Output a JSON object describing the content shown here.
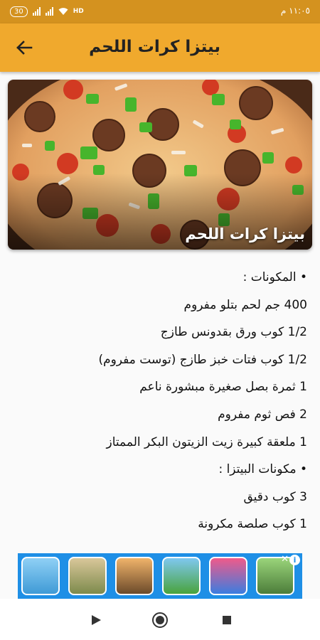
{
  "status_bar": {
    "time": "١١:٠٥ م",
    "battery": "30",
    "network": "HD"
  },
  "app_bar": {
    "title": "بيتزا كرات اللحم",
    "back_icon": "arrow-back-icon"
  },
  "hero": {
    "caption": "بيتزا كرات اللحم"
  },
  "content": {
    "lines": [
      {
        "text": "المكونات :",
        "type": "section"
      },
      {
        "text": "400 جم لحم بتلو مفروم",
        "type": "item"
      },
      {
        "text": "1/2 كوب ورق بقدونس طازج",
        "type": "item"
      },
      {
        "text": "1/2 كوب فتات خبز طازج (توست مفروم)",
        "type": "item"
      },
      {
        "text": "1 ثمرة بصل صغيرة مبشورة ناعم",
        "type": "item"
      },
      {
        "text": "2 فص ثوم مفروم",
        "type": "item"
      },
      {
        "text": "1 ملعقة كبيرة زيت الزيتون البكر الممتاز",
        "type": "item"
      },
      {
        "text": "مكونات البيتزا :",
        "type": "section"
      },
      {
        "text": "3 كوب دقيق",
        "type": "item"
      },
      {
        "text": "1 كوب صلصة مكرونة",
        "type": "item"
      }
    ]
  },
  "ad": {
    "info_icon": "info-icon",
    "close_icon": "close-icon"
  },
  "nav_bar": {
    "back": "triangle-back-icon",
    "home": "circle-home-icon",
    "recents": "square-recents-icon"
  },
  "colors": {
    "status_bar": "#d4921f",
    "app_bar": "#f0a92d",
    "ad_background": "#1e8fe6"
  }
}
